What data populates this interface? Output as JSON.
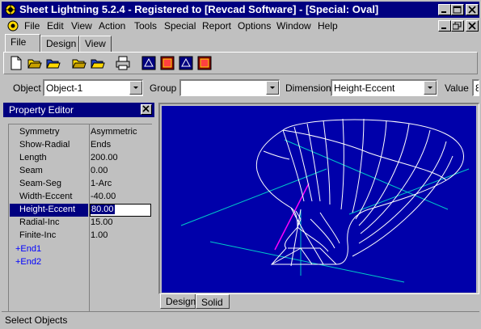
{
  "window": {
    "title": "Sheet Lightning 5.2.4 - Registered to [Revcad Software] - [Special: Oval]",
    "icons": [
      "app-icon",
      "minimize-icon",
      "maximize-icon",
      "close-icon"
    ]
  },
  "menu": {
    "items": [
      "File",
      "Edit",
      "View",
      "Action",
      "Tools",
      "Special",
      "Report",
      "Options",
      "Window",
      "Help"
    ]
  },
  "tabs": {
    "items": [
      "File",
      "Design",
      "View"
    ],
    "active": "File"
  },
  "toolbar": {
    "buttons": [
      "new-file-icon",
      "open-file-icon",
      "open-folder-icon",
      "open-alt-icon",
      "save-icon",
      "print-icon",
      "view-front-icon",
      "view-red-icon",
      "view-side-icon",
      "view-red2-icon"
    ]
  },
  "selection": {
    "object_label": "Object",
    "object_value": "Object-1",
    "group_label": "Group",
    "group_value": "",
    "dimension_label": "Dimension",
    "dimension_value": "Height-Eccent",
    "value_label": "Value",
    "value_value": "8"
  },
  "property_editor": {
    "title": "Property Editor",
    "rows": [
      {
        "name": "Symmetry",
        "value": "Asymmetric"
      },
      {
        "name": "Show-Radial",
        "value": "Ends"
      },
      {
        "name": "Length",
        "value": "200.00"
      },
      {
        "name": "Seam",
        "value": "0.00"
      },
      {
        "name": "Seam-Seg",
        "value": "1-Arc"
      },
      {
        "name": "Width-Eccent",
        "value": "-40.00"
      },
      {
        "name": "Height-Eccent",
        "value": "80.00"
      },
      {
        "name": "Radial-Inc",
        "value": "15.00"
      },
      {
        "name": "Finite-Inc",
        "value": "1.00"
      }
    ],
    "selected_row": "Height-Eccent",
    "groups": [
      "+End1",
      "+End2"
    ]
  },
  "view_tabs": {
    "items": [
      "Design",
      "Solid"
    ],
    "active": "Design"
  },
  "status": {
    "text": "Select Objects"
  },
  "colors": {
    "title_bar": "#000080",
    "canvas": "#0000aa",
    "wireframe": "#ffffff",
    "axis_lines": "#00c8c8",
    "seam_line": "#ff00ff"
  }
}
